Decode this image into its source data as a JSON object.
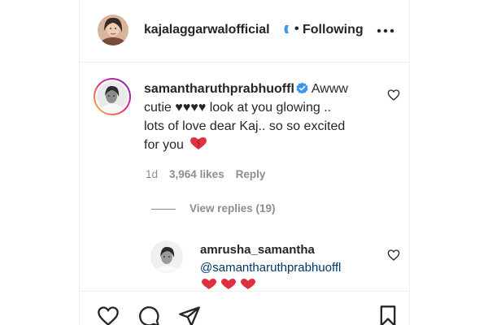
{
  "post": {
    "author": "kajalaggarwalofficial",
    "separator": "•",
    "follow_status": "Following"
  },
  "comment": {
    "username": "samantharuthprabhuoffl",
    "text_line1": "Awww",
    "text_line2": "cutie ♥♥♥♥ look at you glowing ..",
    "text_line3": "lots of love dear Kaj.. so so excited",
    "text_line4": "for you",
    "age": "1d",
    "likes": "3,964 likes",
    "reply_label": "Reply",
    "view_replies": "View replies (19)"
  },
  "reply": {
    "username": "amrusha_samantha",
    "mention": "@samantharuthprabhuoffl"
  },
  "colors": {
    "verified": "#3897f0",
    "heart": "#ed4956",
    "text": "#262626",
    "muted": "#8e8e8e",
    "link": "#00376b"
  },
  "icons": [
    "more-icon",
    "verified-badge-icon",
    "heart-outline-icon",
    "heart-red-emoji-icon",
    "comment-icon",
    "share-icon",
    "bookmark-icon"
  ]
}
